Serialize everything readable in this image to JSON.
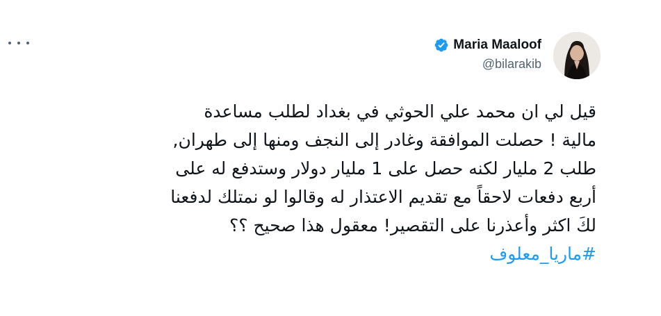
{
  "author": {
    "name": "Maria Maaloof",
    "handle": "@bilarakib",
    "verified_color": "#1d9bf0"
  },
  "tweet": {
    "lines": [
      "قيل لي ان محمد علي الحوثي في بغداد لطلب مساعدة",
      "مالية ! حصلت الموافقة وغادر إلى النجف ومنها إلى طهران,",
      "طلب 2 مليار لكنه حصل على 1 مليار دولار وستدفع له على",
      "أربع دفعات لاحقاً مع تقديم الاعتذار له وقالوا لو نمتلك لدفعنا",
      "لكَ اكثر وأعذرنا على التقصير! معقول هذا صحيح ؟؟"
    ],
    "hashtag": "#ماريا_معلوف"
  },
  "icons": {
    "more": "more-horizontal-icon",
    "verified": "verified-badge-icon"
  },
  "colors": {
    "text": "#0f1419",
    "secondary": "#536471",
    "link": "#1d9bf0"
  }
}
